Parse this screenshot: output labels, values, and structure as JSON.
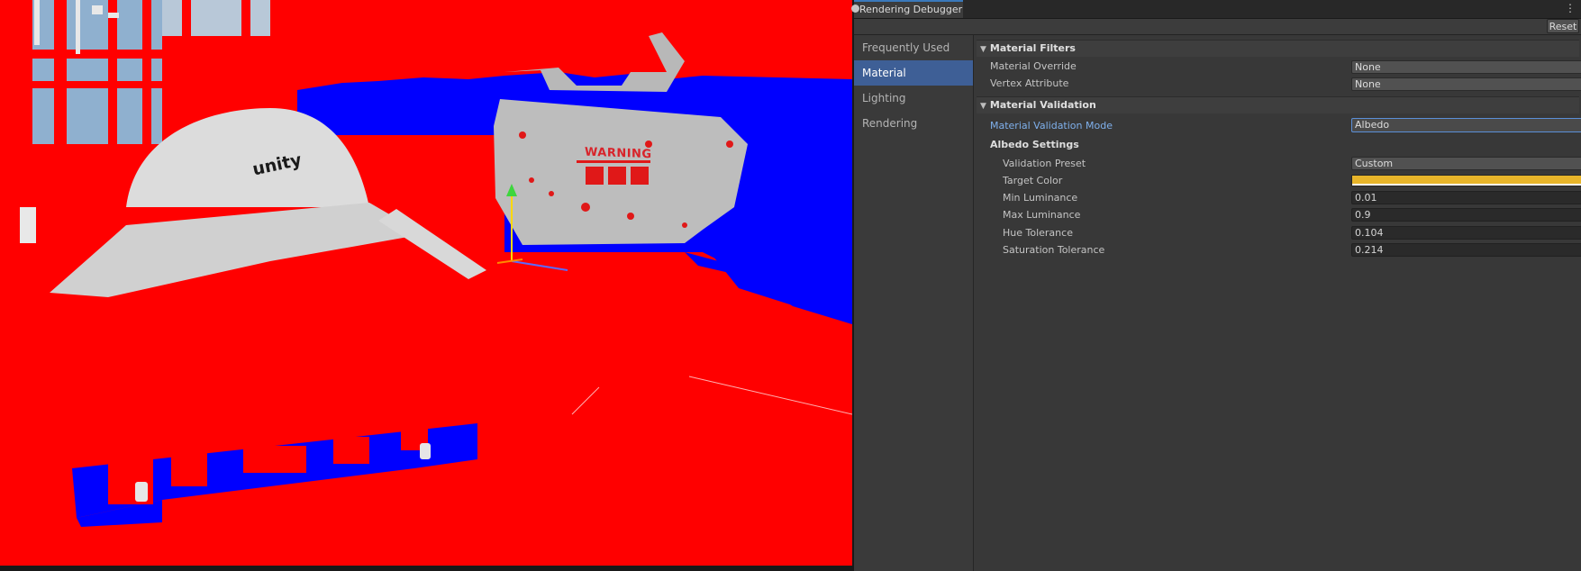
{
  "window": {
    "tab_title": "Rendering Debugger",
    "menu_icon": "kebab-menu-icon",
    "reset_label": "Reset"
  },
  "scene": {
    "warning_text": "WARNING",
    "logo_text": "unity"
  },
  "sidebar": {
    "items": [
      {
        "label": "Frequently Used"
      },
      {
        "label": "Material",
        "active": true
      },
      {
        "label": "Lighting"
      },
      {
        "label": "Rendering"
      }
    ]
  },
  "material_filters": {
    "header": "Material Filters",
    "material_override_label": "Material Override",
    "material_override_value": "None",
    "vertex_attribute_label": "Vertex Attribute",
    "vertex_attribute_value": "None"
  },
  "material_validation": {
    "header": "Material Validation",
    "mode_label": "Material Validation Mode",
    "mode_value": "Albedo",
    "albedo_settings_label": "Albedo Settings",
    "validation_preset_label": "Validation Preset",
    "validation_preset_value": "Custom",
    "target_color_label": "Target Color",
    "target_color": "#e8b52a",
    "min_luminance_label": "Min Luminance",
    "min_luminance_value": "0.01",
    "max_luminance_label": "Max Luminance",
    "max_luminance_value": "0.9",
    "hue_tolerance_label": "Hue Tolerance",
    "hue_tolerance_value": "0.104",
    "saturation_tolerance_label": "Saturation Tolerance",
    "saturation_tolerance_value": "0.214"
  },
  "colors": {
    "accent": "#3e5f96",
    "scene_red": "#ff0000",
    "scene_blue": "#0000ff"
  }
}
